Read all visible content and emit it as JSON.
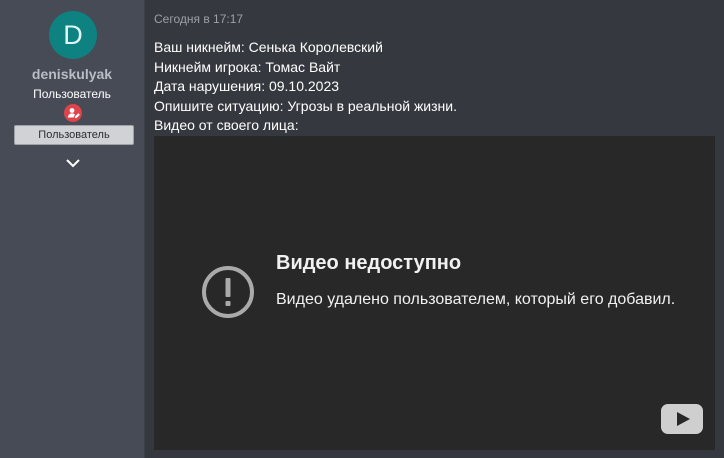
{
  "author": {
    "avatar_letter": "D",
    "avatar_color": "#0e8281",
    "username": "deniskulyak",
    "title": "Пользователь",
    "role_icon": "user-role-badge-icon",
    "banner": "Пользователь",
    "expand_icon": "chevron-down-icon"
  },
  "post": {
    "timestamp": "Сегодня в 17:17",
    "lines": [
      "Ваш никнейм: Сенька Королевский",
      "Никнейм игрока: Томас Вайт",
      "Дата нарушения: 09.10.2023",
      "Опишите ситуацию: Угрозы в реальной жизни.",
      "Видео от своего лица:"
    ]
  },
  "video": {
    "error_icon": "exclamation-circle-icon",
    "title": "Видео недоступно",
    "message": "Видео удалено пользователем, который его добавил.",
    "logo_icon": "youtube-logo-icon"
  }
}
